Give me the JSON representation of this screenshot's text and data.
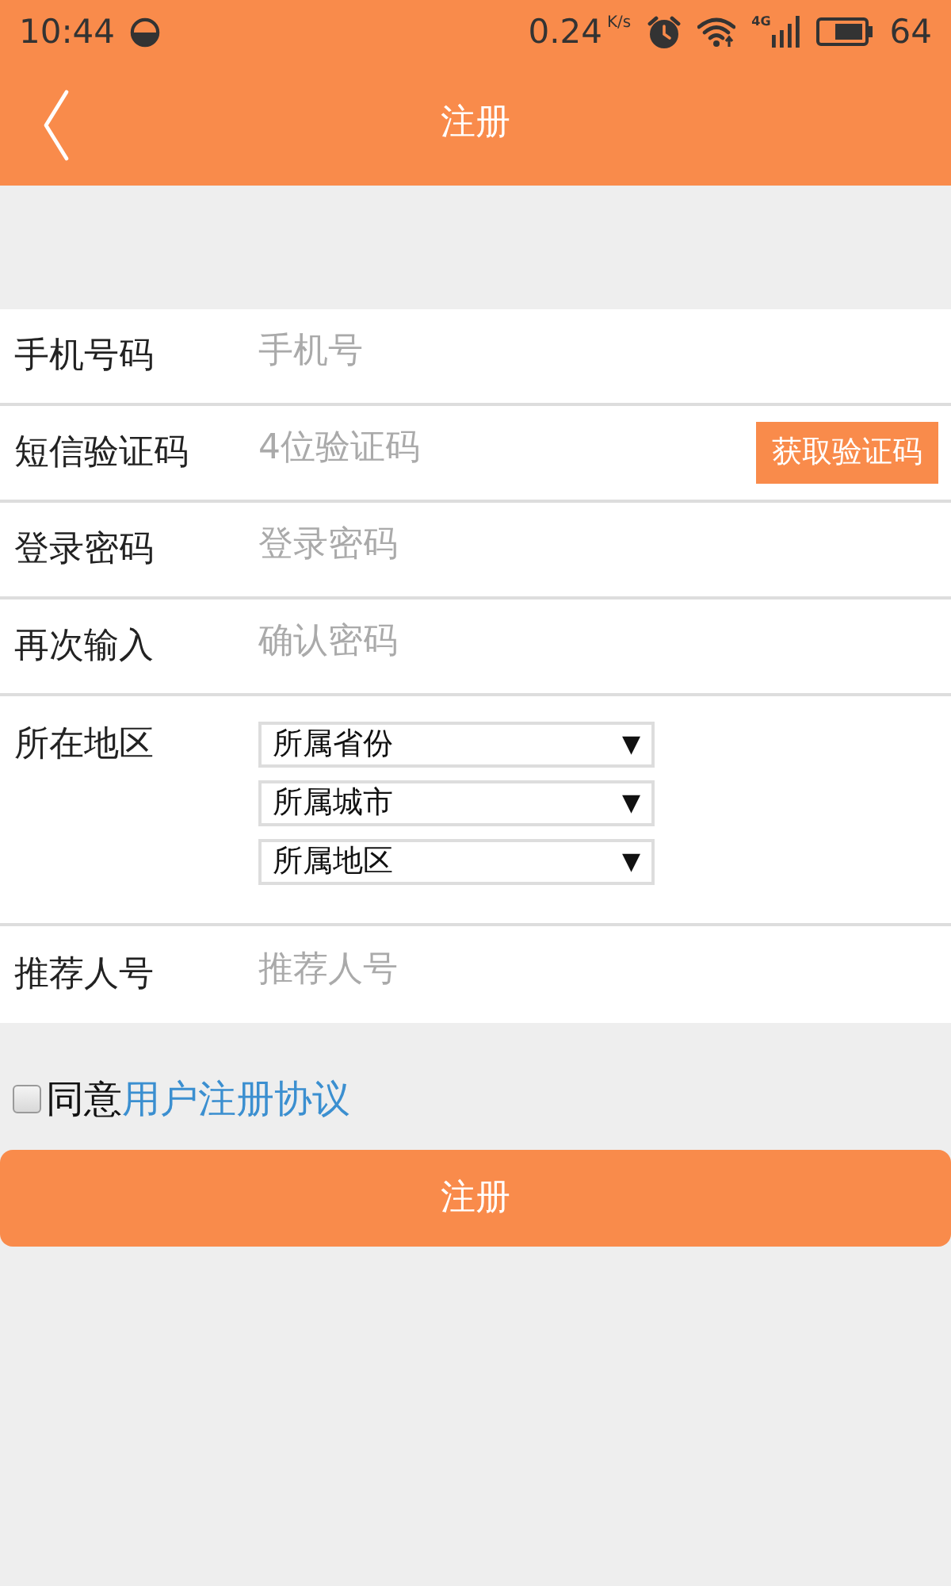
{
  "status_bar": {
    "time": "10:44",
    "speed": "0.24",
    "speed_unit": "K/s",
    "network_type": "4G",
    "battery": "64"
  },
  "header": {
    "title": "注册"
  },
  "form": {
    "rows": [
      {
        "kind": "input",
        "label": "手机号码",
        "placeholder": "手机号"
      },
      {
        "kind": "input_button",
        "label": "短信验证码",
        "placeholder": "4位验证码",
        "button": "获取验证码"
      },
      {
        "kind": "input",
        "label": "登录密码",
        "placeholder": "登录密码"
      },
      {
        "kind": "input",
        "label": "再次输入",
        "placeholder": "确认密码"
      },
      {
        "kind": "selects",
        "label": "所在地区",
        "selects": [
          {
            "value": "所属省份",
            "arrow": "▼"
          },
          {
            "value": "所属城市",
            "arrow": "▼"
          },
          {
            "value": "所属地区",
            "arrow": "▼"
          }
        ]
      },
      {
        "kind": "input",
        "label": "推荐人号",
        "placeholder": "推荐人号"
      }
    ]
  },
  "agreement": {
    "checked": false,
    "text": "同意",
    "link": "用户注册协议"
  },
  "submit": {
    "label": "注册"
  }
}
